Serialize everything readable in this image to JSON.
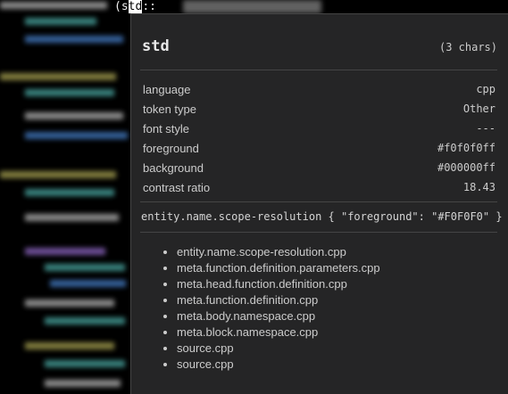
{
  "editor": {
    "selected_token": "std",
    "code_prefix": "(s",
    "code_suffix": "::"
  },
  "hover": {
    "title": "std",
    "char_count": "(3 chars)",
    "properties": [
      {
        "label": "language",
        "value": "cpp"
      },
      {
        "label": "token type",
        "value": "Other"
      },
      {
        "label": "font style",
        "value": "---"
      },
      {
        "label": "foreground",
        "value": "#f0f0f0ff"
      },
      {
        "label": "background",
        "value": "#000000ff"
      },
      {
        "label": "contrast ratio",
        "value": "18.43"
      }
    ],
    "theme_rule": "entity.name.scope-resolution { \"foreground\": \"#F0F0F0\" }",
    "scopes": [
      "entity.name.scope-resolution.cpp",
      "meta.function.definition.parameters.cpp",
      "meta.head.function.definition.cpp",
      "meta.function.definition.cpp",
      "meta.body.namespace.cpp",
      "meta.block.namespace.cpp",
      "source.cpp",
      "source.cpp"
    ]
  },
  "colors": {
    "hover_bg": "#252526",
    "border": "#454545",
    "editor_bg": "#000000"
  }
}
